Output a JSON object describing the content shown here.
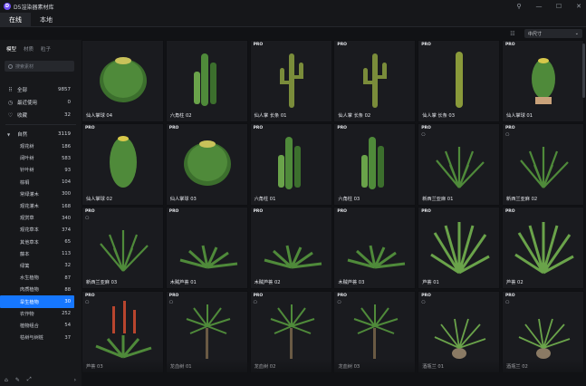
{
  "app": {
    "title": "D5渲染器素材库"
  },
  "window_controls": [
    {
      "name": "pin-icon",
      "glyph": "⚲"
    },
    {
      "name": "minimize-icon",
      "glyph": "—"
    },
    {
      "name": "maximize-icon",
      "glyph": "☐"
    },
    {
      "name": "close-icon",
      "glyph": "✕"
    }
  ],
  "tabs": [
    {
      "label": "在线",
      "active": true
    },
    {
      "label": "本地",
      "active": false
    }
  ],
  "toolbar": {
    "size_label": "中尺寸"
  },
  "sidebar": {
    "subtabs": [
      {
        "label": "模型",
        "active": true
      },
      {
        "label": "材质",
        "active": false
      },
      {
        "label": "粒子",
        "active": false
      }
    ],
    "search_placeholder": "搜索素材",
    "quick": [
      {
        "icon": "grid-icon",
        "glyph": "⠿",
        "label": "全部",
        "count": "9857"
      },
      {
        "icon": "history-icon",
        "glyph": "◷",
        "label": "最近使用",
        "count": "0"
      },
      {
        "icon": "heart-icon",
        "glyph": "♡",
        "label": "收藏",
        "count": "32"
      }
    ],
    "category": {
      "label": "自然",
      "count": "3119"
    },
    "subcategories": [
      {
        "label": "观花树",
        "count": "186"
      },
      {
        "label": "阔叶树",
        "count": "583"
      },
      {
        "label": "针叶树",
        "count": "93"
      },
      {
        "label": "棕榈",
        "count": "104"
      },
      {
        "label": "常绿灌木",
        "count": "300"
      },
      {
        "label": "观花灌木",
        "count": "168"
      },
      {
        "label": "观赏草",
        "count": "340"
      },
      {
        "label": "观花草本",
        "count": "374"
      },
      {
        "label": "其他草本",
        "count": "65"
      },
      {
        "label": "藤本",
        "count": "113"
      },
      {
        "label": "绿篱",
        "count": "32"
      },
      {
        "label": "水生植物",
        "count": "87"
      },
      {
        "label": "肉质植物",
        "count": "88"
      },
      {
        "label": "旱生植物",
        "count": "30",
        "active": true
      },
      {
        "label": "农作物",
        "count": "252"
      },
      {
        "label": "植物组合",
        "count": "54"
      },
      {
        "label": "枯树与树桩",
        "count": "37"
      }
    ]
  },
  "assets": [
    {
      "name": "仙人掌球 04",
      "pro": false,
      "dl": false,
      "kind": "barrel"
    },
    {
      "name": "六角柱 02",
      "pro": false,
      "dl": false,
      "kind": "column"
    },
    {
      "name": "仙人掌 长条 01",
      "pro": true,
      "dl": false,
      "kind": "saguaro"
    },
    {
      "name": "仙人掌 长条 02",
      "pro": true,
      "dl": false,
      "kind": "saguaro"
    },
    {
      "name": "仙人掌 长条 03",
      "pro": true,
      "dl": false,
      "kind": "pillar"
    },
    {
      "name": "仙人掌球 01",
      "pro": true,
      "dl": false,
      "kind": "barrelpot"
    },
    {
      "name": "仙人掌球 02",
      "pro": true,
      "dl": false,
      "kind": "tallbarrel"
    },
    {
      "name": "仙人掌球 03",
      "pro": true,
      "dl": false,
      "kind": "barrel"
    },
    {
      "name": "六角柱 01",
      "pro": true,
      "dl": false,
      "kind": "column"
    },
    {
      "name": "六角柱 03",
      "pro": true,
      "dl": false,
      "kind": "column"
    },
    {
      "name": "新西兰亚麻 01",
      "pro": true,
      "dl": true,
      "kind": "grass"
    },
    {
      "name": "新西兰亚麻 02",
      "pro": true,
      "dl": true,
      "kind": "grass"
    },
    {
      "name": "新西兰亚麻 03",
      "pro": true,
      "dl": true,
      "kind": "grass"
    },
    {
      "name": "木贼芦荟 01",
      "pro": true,
      "dl": false,
      "kind": "aloe"
    },
    {
      "name": "木贼芦荟 02",
      "pro": true,
      "dl": false,
      "kind": "aloe"
    },
    {
      "name": "木贼芦荟 03",
      "pro": true,
      "dl": false,
      "kind": "aloe"
    },
    {
      "name": "芦荟 01",
      "pro": true,
      "dl": false,
      "kind": "agave"
    },
    {
      "name": "芦荟 02",
      "pro": true,
      "dl": false,
      "kind": "agave"
    },
    {
      "name": "芦荟 03",
      "pro": true,
      "dl": true,
      "kind": "redaloe"
    },
    {
      "name": "龙血树 01",
      "pro": true,
      "dl": true,
      "kind": "dracaena"
    },
    {
      "name": "龙血树 02",
      "pro": true,
      "dl": true,
      "kind": "dracaena"
    },
    {
      "name": "龙血树 03",
      "pro": true,
      "dl": true,
      "kind": "dracaena"
    },
    {
      "name": "酒瓶兰 01",
      "pro": true,
      "dl": true,
      "kind": "ponytail"
    },
    {
      "name": "酒瓶兰 02",
      "pro": true,
      "dl": true,
      "kind": "ponytail"
    }
  ],
  "footer_icons": [
    {
      "name": "tag-icon",
      "glyph": "⌂"
    },
    {
      "name": "edit-icon",
      "glyph": "✎"
    },
    {
      "name": "expand-icon",
      "glyph": "⤢"
    },
    {
      "name": "chevron-right-icon",
      "glyph": "›"
    }
  ],
  "colors": {
    "accent": "#1677ff",
    "bg": "#111215",
    "card": "#1a1b1f"
  }
}
